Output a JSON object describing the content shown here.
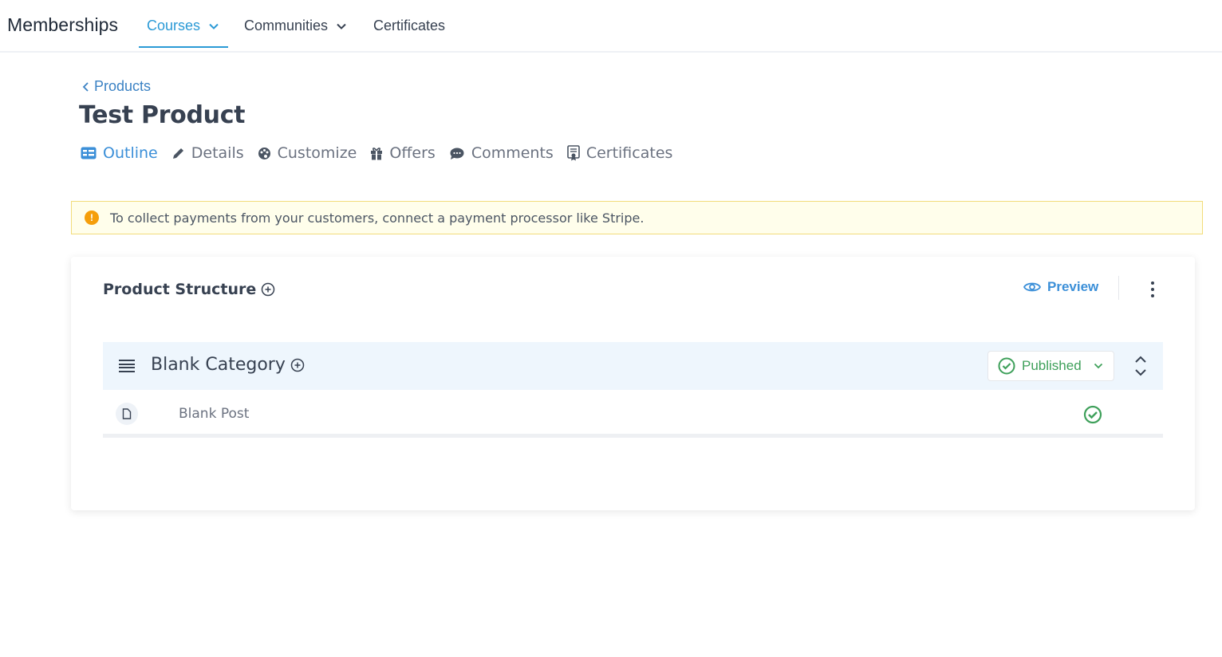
{
  "app": {
    "title": "Memberships"
  },
  "nav": {
    "items": [
      {
        "label": "Courses",
        "has_dropdown": true,
        "active": true
      },
      {
        "label": "Communities",
        "has_dropdown": true,
        "active": false
      },
      {
        "label": "Certificates",
        "has_dropdown": false,
        "active": false
      }
    ]
  },
  "breadcrumb": {
    "back_label": "Products"
  },
  "page": {
    "title": "Test Product"
  },
  "tabs": [
    {
      "label": "Outline",
      "icon": "outline-icon",
      "active": true
    },
    {
      "label": "Details",
      "icon": "pencil-icon",
      "active": false
    },
    {
      "label": "Customize",
      "icon": "palette-icon",
      "active": false
    },
    {
      "label": "Offers",
      "icon": "gift-icon",
      "active": false
    },
    {
      "label": "Comments",
      "icon": "comment-icon",
      "active": false
    },
    {
      "label": "Certificates",
      "icon": "certificate-icon",
      "active": false
    }
  ],
  "alert": {
    "icon": "warning-icon",
    "text": "To collect payments from your customers, connect a payment processor like Stripe."
  },
  "structure": {
    "title": "Product Structure",
    "preview_label": "Preview",
    "categories": [
      {
        "title": "Blank Category",
        "status": "Published",
        "posts": [
          {
            "title": "Blank Post",
            "published": true
          }
        ]
      }
    ]
  },
  "colors": {
    "accent": "#2b9ad6",
    "link": "#3b8fd8",
    "success": "#3ea05a",
    "warning": "#f59e0b",
    "alert_bg": "#fffeeb",
    "category_bg": "#eef6fd"
  }
}
